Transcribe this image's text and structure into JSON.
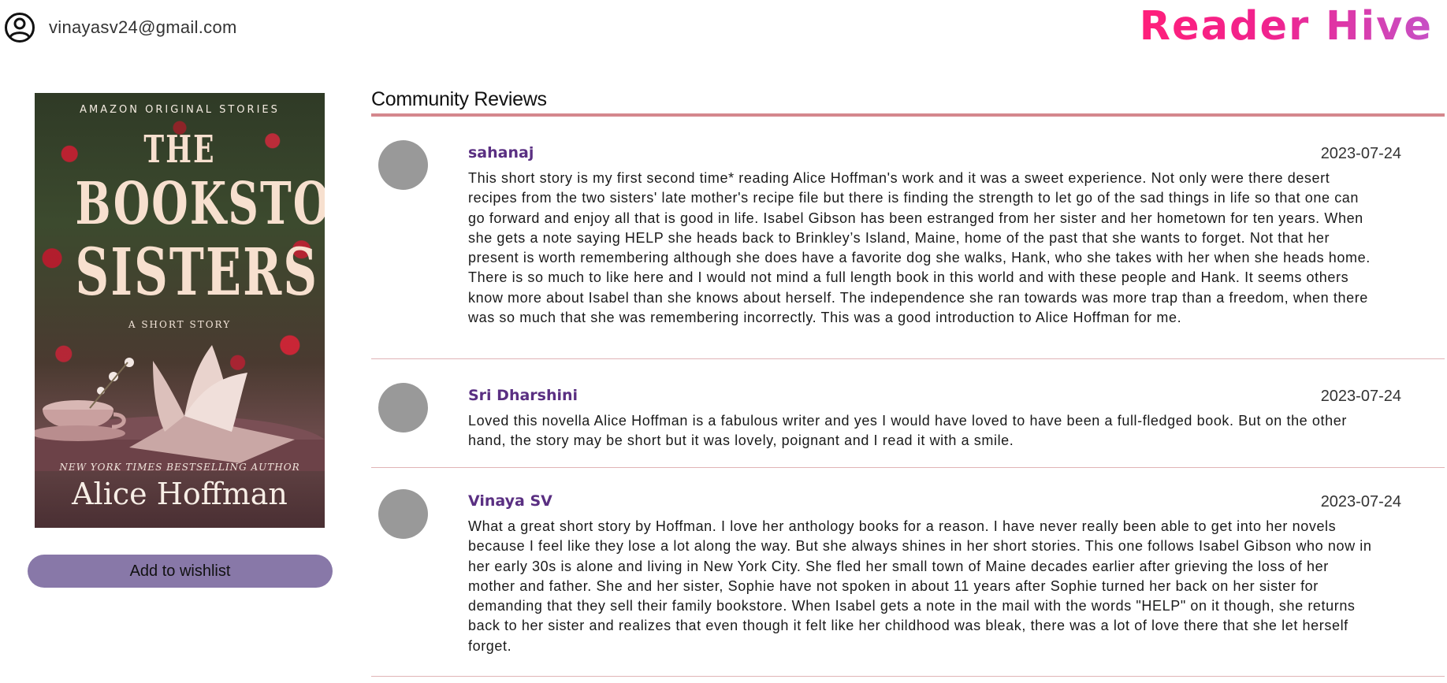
{
  "header": {
    "user_email": "vinayasv24@gmail.com",
    "brand": "Reader Hive",
    "brand_gradient": [
      "#ff1f7a",
      "#f0238f",
      "#c651c6"
    ]
  },
  "book": {
    "cover": {
      "series": "AMAZON ORIGINAL STORIES",
      "title_line1": "THE",
      "title_line2": "BOOKSTORE",
      "title_line3": "SISTERS",
      "subtitle": "A SHORT STORY",
      "tagline": "NEW YORK TIMES BESTSELLING AUTHOR",
      "author": "Alice Hoffman"
    },
    "wishlist_label": "Add to wishlist",
    "wishlist_color": "#8878a8"
  },
  "reviews": {
    "heading": "Community Reviews",
    "accent_color": "#d4878d",
    "items": [
      {
        "name": "sahanaj",
        "date": "2023-07-24",
        "text": "This short story is my first second time* reading Alice Hoffman's work and it was a sweet experience. Not only were there desert recipes from the two sisters' late mother's recipe file but there is finding the strength to let go of the sad things in life so that one can go forward and enjoy all that is good in life. Isabel Gibson has been estranged from her sister and her hometown for ten years. When she gets a note saying HELP she heads back to Brinkley’s Island, Maine, home of the past that she wants to forget. Not that her present is worth remembering although she does have a favorite dog she walks, Hank, who she takes with her when she heads home. There is so much to like here and I would not mind a full length book in this world and with these people and Hank. It seems others know more about Isabel than she knows about herself. The independence she ran towards was more trap than a freedom, when there was so much that she was remembering incorrectly. This was a good introduction to Alice Hoffman for me."
      },
      {
        "name": "Sri Dharshini",
        "date": "2023-07-24",
        "text": "Loved this novella Alice Hoffman is a fabulous writer and yes I would have loved to have been a full-fledged book. But on the other hand, the story may be short but it was lovely, poignant and I read it with a smile."
      },
      {
        "name": "Vinaya SV",
        "date": "2023-07-24",
        "text": "What a great short story by Hoffman. I love her anthology books for a reason. I have never really been able to get into her novels because I feel like they lose a lot along the way. But she always shines in her short stories. This one follows Isabel Gibson who now in her early 30s is alone and living in New York City. She fled her small town of Maine decades earlier after grieving the loss of her mother and father. She and her sister, Sophie have not spoken in about 11 years after Sophie turned her back on her sister for demanding that they sell their family bookstore. When Isabel gets a note in the mail with the words \"HELP\" on it though, she returns back to her sister and realizes that even though it felt like her childhood was bleak, there was a lot of love there that she let herself forget."
      }
    ]
  }
}
